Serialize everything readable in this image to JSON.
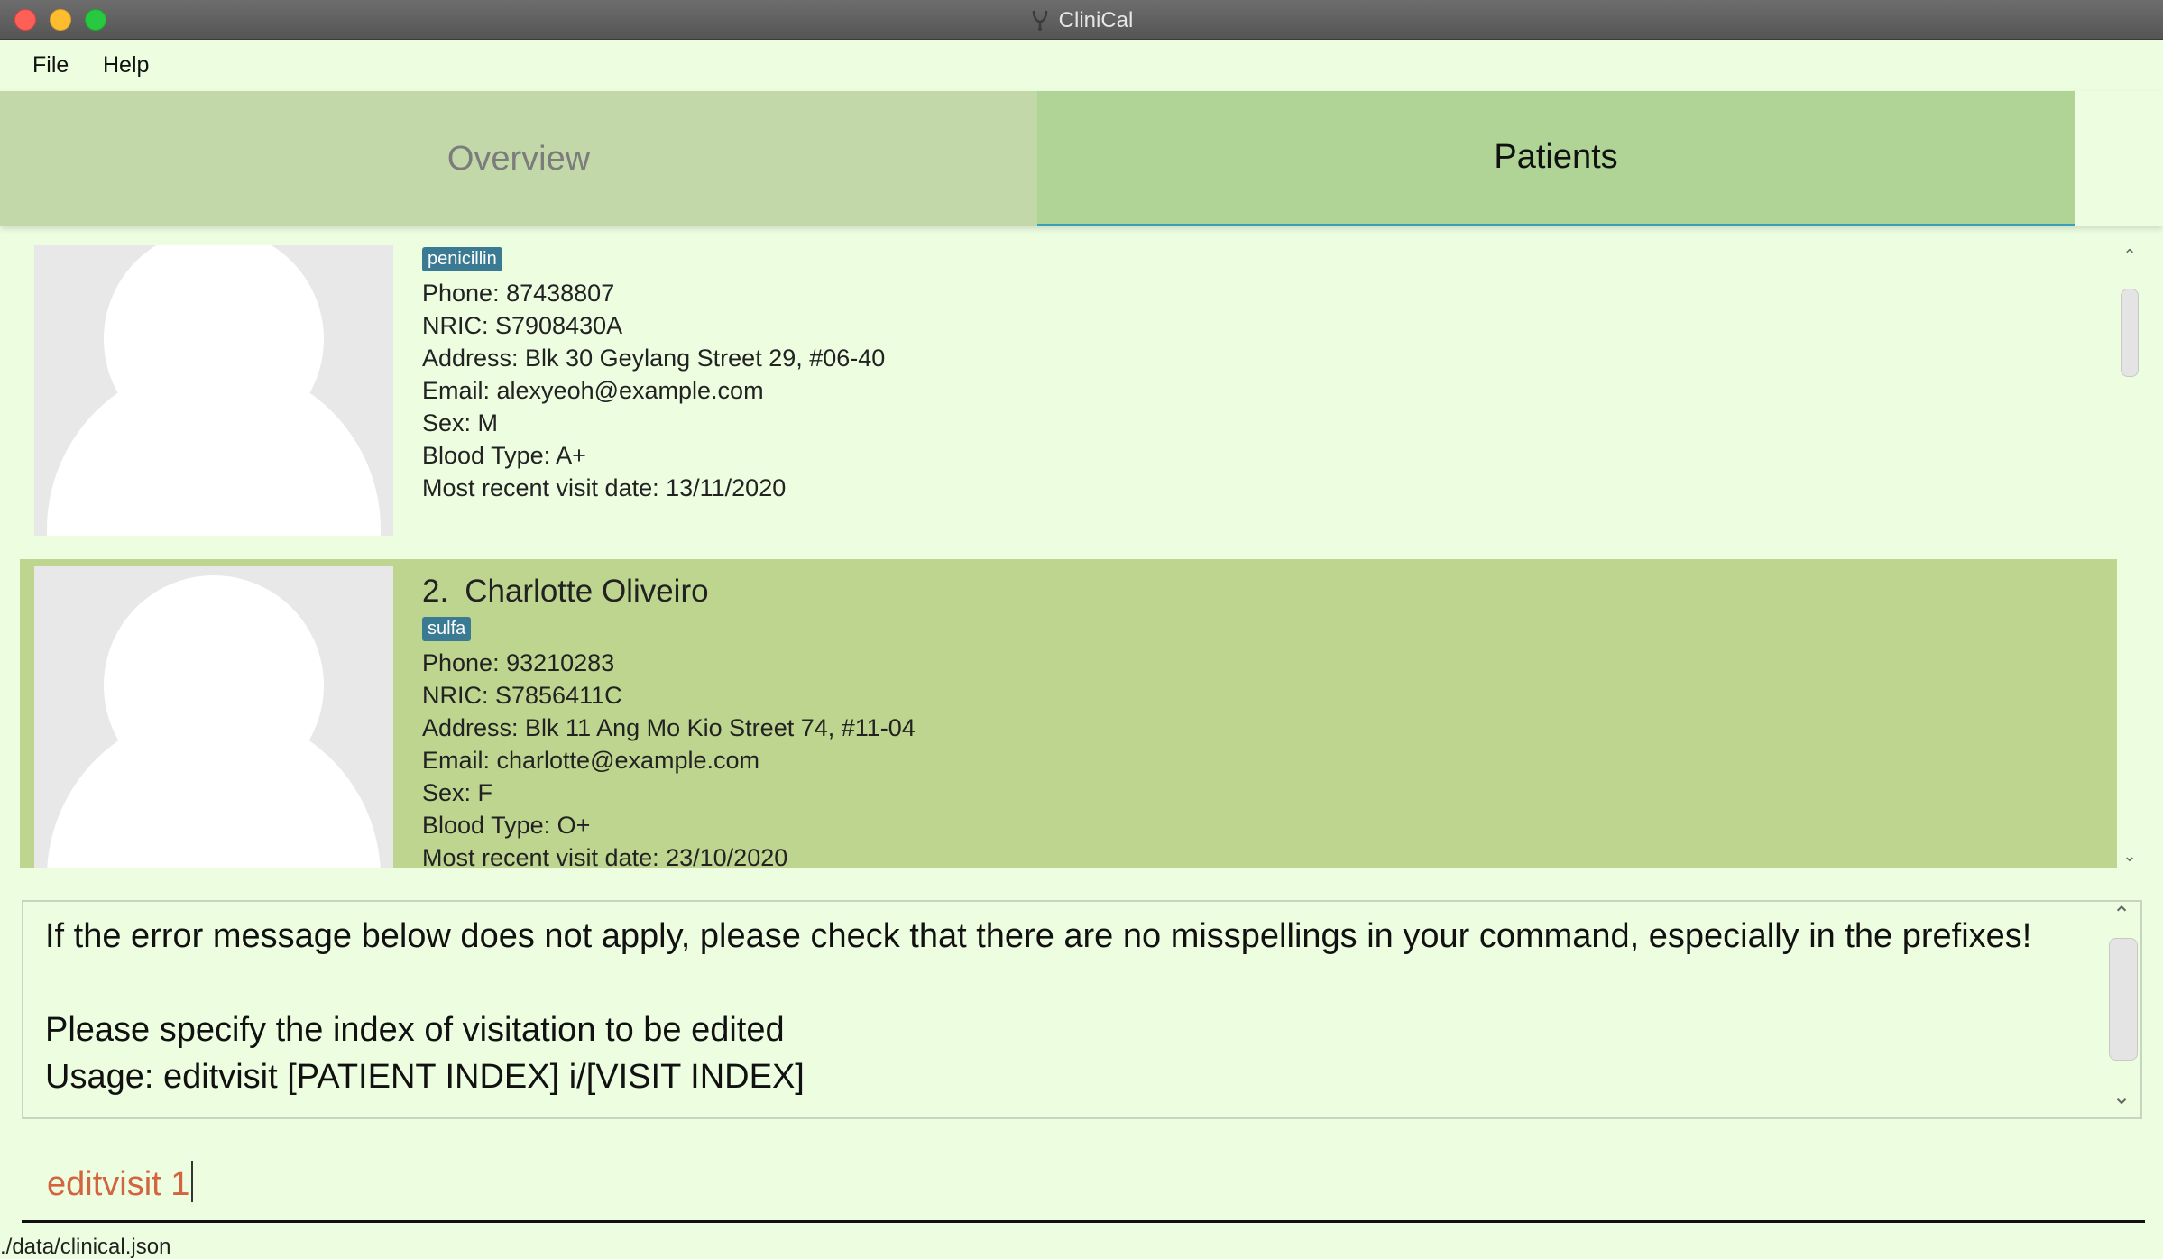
{
  "window": {
    "title": "CliniCal"
  },
  "menu": {
    "items": [
      "File",
      "Help"
    ]
  },
  "tabs": [
    {
      "label": "Overview",
      "selected": false
    },
    {
      "label": "Patients",
      "selected": true
    }
  ],
  "patients": [
    {
      "index": "",
      "name": "",
      "tag": "penicillin",
      "phone": "Phone: 87438807",
      "nric": "NRIC: S7908430A",
      "address": "Address: Blk 30 Geylang Street 29, #06-40",
      "email": "Email: alexyeoh@example.com",
      "sex": "Sex: M",
      "blood_type": "Blood Type: A+",
      "last_visit": "Most recent visit date: 13/11/2020"
    },
    {
      "index": "2.",
      "name": "Charlotte Oliveiro",
      "tag": "sulfa",
      "phone": "Phone: 93210283",
      "nric": "NRIC: S7856411C",
      "address": "Address: Blk 11 Ang Mo Kio Street 74, #11-04",
      "email": "Email: charlotte@example.com",
      "sex": "Sex: F",
      "blood_type": "Blood Type: O+",
      "last_visit": "Most recent visit date: 23/10/2020"
    }
  ],
  "result": {
    "line1": "If the error message below does not apply, please check that there are no misspellings in your command, especially in the prefixes!",
    "line2": "Please specify the index of visitation to be edited",
    "line3": "Usage: editvisit [PATIENT INDEX] i/[VISIT INDEX]"
  },
  "command": {
    "value": "editvisit 1"
  },
  "status": {
    "path": "./data/clinical.json"
  },
  "colors": {
    "background": "#ecfde0",
    "tab_selected": "#b0d496",
    "tab_unselected": "#c2d8a8",
    "card_selected": "#bed58f",
    "tag": "#3a7a92",
    "command_text": "#d4633f"
  }
}
